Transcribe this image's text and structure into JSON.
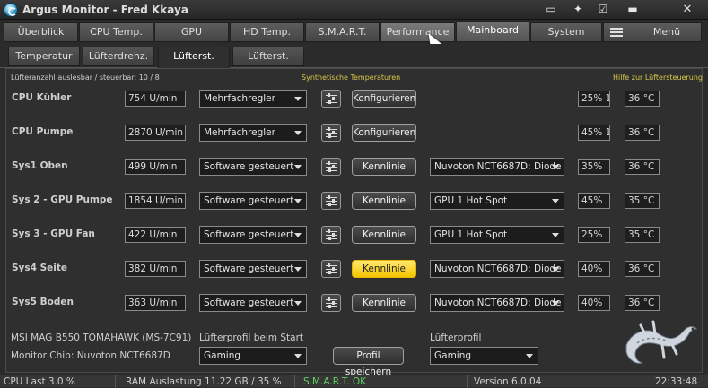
{
  "window": {
    "title": "Argus Monitor - Fred Kkaya",
    "close_symbol": "✕",
    "title_icons": [
      "window-icon",
      "pin-icon",
      "checkbox-icon",
      "minimize-icon"
    ]
  },
  "main_tabs": [
    {
      "label": "Überblick"
    },
    {
      "label": "CPU Temp."
    },
    {
      "label": "GPU"
    },
    {
      "label": "HD Temp."
    },
    {
      "label": "S.M.A.R.T."
    },
    {
      "label": "Performance"
    },
    {
      "label": "Mainboard"
    },
    {
      "label": "System"
    }
  ],
  "menu_tab": {
    "label": "Menü"
  },
  "sub_tabs": [
    {
      "label": "Temperatur"
    },
    {
      "label": "Lüfterdrehz."
    },
    {
      "label": "Lüfterst."
    },
    {
      "label": "Lüfterst."
    }
  ],
  "header": {
    "fan_count": "Lüfteranzahl auslesbar / steuerbar: 10 / 8",
    "synthetic": "Synthetische Temperaturen",
    "help": "Hilfe zur Lüftersteuerung"
  },
  "fans": [
    {
      "name": "CPU Kühler",
      "rpm": "754 U/min",
      "mode": "Mehrfachregler",
      "action": "Konfigurieren",
      "source": "",
      "pct": "25% 1",
      "temp": "36 °C",
      "highlight": false
    },
    {
      "name": "CPU Pumpe",
      "rpm": "2870 U/min",
      "mode": "Mehrfachregler",
      "action": "Konfigurieren",
      "source": "",
      "pct": "45% 1",
      "temp": "36 °C",
      "highlight": false
    },
    {
      "name": "Sys1 Oben",
      "rpm": "499 U/min",
      "mode": "Software gesteuert",
      "action": "Kennlinie",
      "source": "Nuvoton NCT6687D: Diode",
      "pct": "35%",
      "temp": "36 °C",
      "highlight": false
    },
    {
      "name": "Sys 2 - GPU Pumpe",
      "rpm": "1854 U/min",
      "mode": "Software gesteuert",
      "action": "Kennlinie",
      "source": "GPU 1 Hot Spot",
      "pct": "45%",
      "temp": "35 °C",
      "highlight": false
    },
    {
      "name": "Sys 3 - GPU Fan",
      "rpm": "422 U/min",
      "mode": "Software gesteuert",
      "action": "Kennlinie",
      "source": "GPU 1 Hot Spot",
      "pct": "25%",
      "temp": "35 °C",
      "highlight": false
    },
    {
      "name": "Sys4 Seite",
      "rpm": "382 U/min",
      "mode": "Software gesteuert",
      "action": "Kennlinie",
      "source": "Nuvoton NCT6687D: Diode",
      "pct": "40%",
      "temp": "36 °C",
      "highlight": true
    },
    {
      "name": "Sys5 Boden",
      "rpm": "363 U/min",
      "mode": "Software gesteuert",
      "action": "Kennlinie",
      "source": "Nuvoton NCT6687D: Diode",
      "pct": "40%",
      "temp": "36 °C",
      "highlight": false
    }
  ],
  "footer": {
    "board": "MSI MAG B550 TOMAHAWK (MS-7C91)",
    "chip": "Monitor Chip: Nuvoton NCT6687D",
    "startup_profile_label": "Lüfterprofil beim Start",
    "startup_profile_value": "Gaming",
    "save_profile": "Profil speichern",
    "profile_label": "Lüfterprofil",
    "profile_value": "Gaming"
  },
  "statusbar": {
    "cpu": "CPU Last 3.0 %",
    "ram": "RAM Auslastung 11.22 GB / 35 %",
    "smart": "S.M.A.R.T. OK",
    "version": "Version 6.0.04",
    "time": "22:33:48"
  },
  "colors": {
    "accent_yellow": "#f5c400",
    "header_yellow": "#d9c84a",
    "smart_ok": "#5fd35f"
  }
}
